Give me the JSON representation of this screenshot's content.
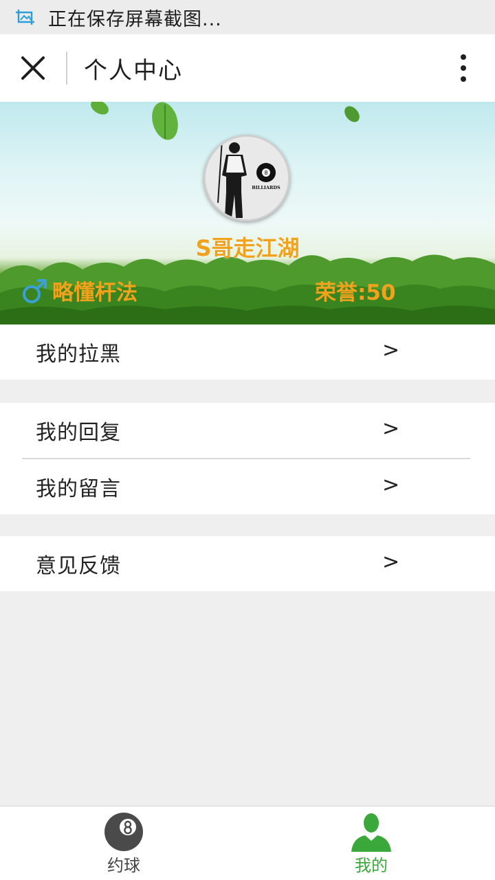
{
  "status_bar": {
    "text": "正在保存屏幕截图...",
    "icon": "screenshot-icon"
  },
  "title_bar": {
    "title": "个人中心",
    "close_icon": "close-icon",
    "more_icon": "more-vertical-icon"
  },
  "profile": {
    "username": "S哥走江湖",
    "gender_icon": "male-icon",
    "skill_level": "略懂杆法",
    "honor": "荣誉:50",
    "avatar_text": "BILLIARDS"
  },
  "menu": {
    "group1": [
      {
        "label": "我的拉黑",
        "chevron": ">"
      }
    ],
    "group2": [
      {
        "label": "我的回复",
        "chevron": ">"
      },
      {
        "label": "我的留言",
        "chevron": ">"
      }
    ],
    "group3": [
      {
        "label": "意见反馈",
        "chevron": ">"
      }
    ]
  },
  "tab_bar": {
    "tabs": [
      {
        "label": "约球",
        "icon": "billiard-ball-icon",
        "active": false
      },
      {
        "label": "我的",
        "icon": "person-icon",
        "active": true
      }
    ]
  },
  "colors": {
    "accent_orange": "#f0a21c",
    "active_green": "#3aa83a",
    "gender_blue": "#3aa0d6"
  }
}
